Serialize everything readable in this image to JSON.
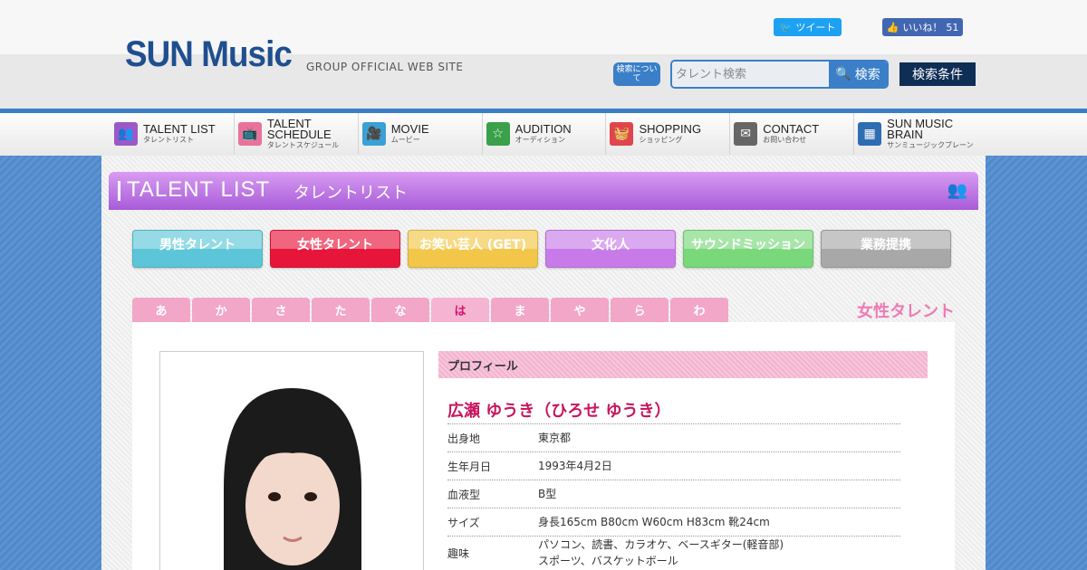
{
  "header": {
    "logo": "SUN Music",
    "logo_sub": "GROUP OFFICIAL WEB SITE",
    "tweet_label": "ツイート",
    "like_label": "いいね！",
    "like_count": "51",
    "about_search": "検索について",
    "search_placeholder": "タレント検索",
    "search_button": "検索",
    "conditions_button": "検索条件"
  },
  "nav": [
    {
      "en": "TALENT LIST",
      "jp": "タレントリスト",
      "icon": "people-icon",
      "color": "#9b59c7"
    },
    {
      "en": "TALENT SCHEDULE",
      "jp": "タレントスケジュール",
      "icon": "tv-icon",
      "color": "#e9729b"
    },
    {
      "en": "MOVIE",
      "jp": "ムービー",
      "icon": "camera-icon",
      "color": "#3aa0d5"
    },
    {
      "en": "AUDITION",
      "jp": "オーディション",
      "icon": "star-icon",
      "color": "#3aa04a"
    },
    {
      "en": "SHOPPING",
      "jp": "ショッピング",
      "icon": "basket-icon",
      "color": "#e0454b"
    },
    {
      "en": "CONTACT",
      "jp": "お問い合わせ",
      "icon": "mail-icon",
      "color": "#666666"
    },
    {
      "en": "SUN MUSIC BRAIN",
      "jp": "サンミュージックブレーン",
      "icon": "building-icon",
      "color": "#2f6db3"
    }
  ],
  "section": {
    "title": "TALENT LIST",
    "title_jp": "タレントリスト"
  },
  "categories": [
    {
      "label": "男性タレント",
      "color": "#5cc6d8"
    },
    {
      "label": "女性タレント",
      "color": "#e8153b"
    },
    {
      "label": "お笑い芸人 (GET)",
      "color": "#f2c648"
    },
    {
      "label": "文化人",
      "color": "#c87be8"
    },
    {
      "label": "サウンドミッション",
      "color": "#78d87a"
    },
    {
      "label": "業務提携",
      "color": "#a8a8a8"
    }
  ],
  "kana": [
    "あ",
    "か",
    "さ",
    "た",
    "な",
    "は",
    "ま",
    "や",
    "ら",
    "わ"
  ],
  "kana_active": "は",
  "current_category": "女性タレント",
  "profile": {
    "heading": "プロフィール",
    "name": "広瀬 ゆうき（ひろせ ゆうき）",
    "rows": [
      {
        "k": "出身地",
        "v": "東京都"
      },
      {
        "k": "生年月日",
        "v": "1993年4月2日"
      },
      {
        "k": "血液型",
        "v": "B型"
      },
      {
        "k": "サイズ",
        "v": "身長165cm B80cm W60cm H83cm 靴24cm"
      },
      {
        "k": "趣味",
        "v": "パソコン、読書、カラオケ、ベースギター(軽音部)\nスポーツ、バスケットボール"
      }
    ]
  }
}
